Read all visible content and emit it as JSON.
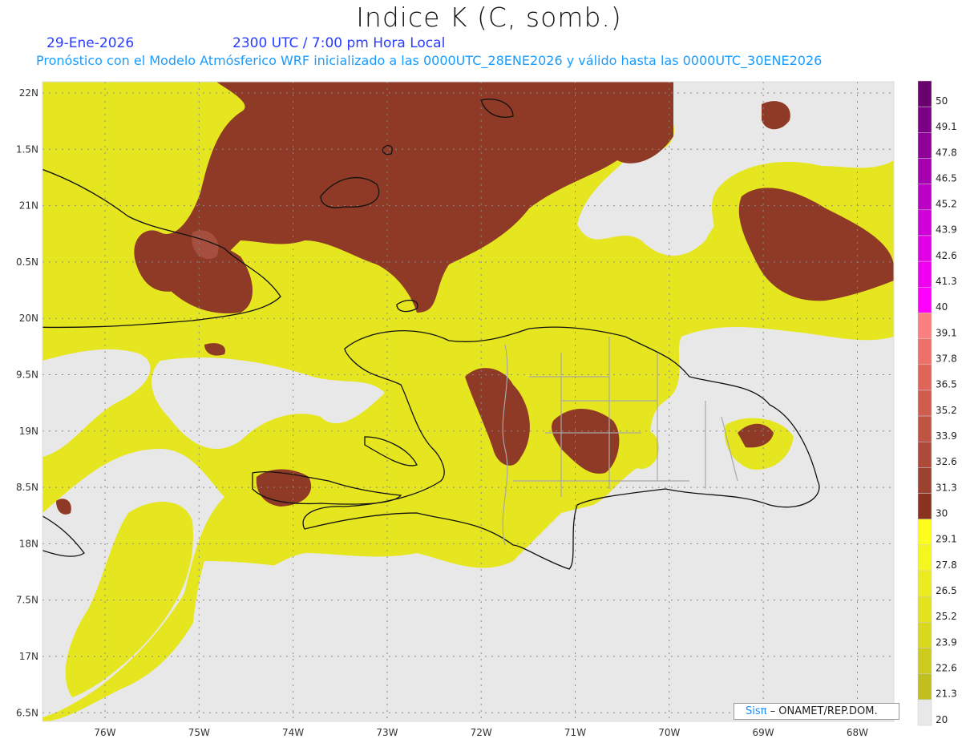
{
  "header": {
    "title": "Indice K (C, somb.)",
    "date": "29-Ene-2026",
    "time": "2300 UTC / 7:00 pm Hora Local",
    "description": "Pronóstico con el Modelo Atmósferico WRF inicializado a las 0000UTC_28ENE2026 y válido hasta las  0000UTC_30ENE2026"
  },
  "map": {
    "lat_labels": [
      "22N",
      "1.5N",
      "21N",
      "0.5N",
      "20N",
      "9.5N",
      "19N",
      "8.5N",
      "18N",
      "7.5N",
      "17N",
      "6.5N"
    ],
    "lon_labels": [
      "76W",
      "75W",
      "74W",
      "73W",
      "72W",
      "71W",
      "70W",
      "69W",
      "68W"
    ]
  },
  "colorbar": {
    "labels": [
      "50",
      "49.1",
      "47.8",
      "46.5",
      "45.2",
      "43.9",
      "42.6",
      "41.3",
      "40",
      "39.1",
      "37.8",
      "36.5",
      "35.2",
      "33.9",
      "32.6",
      "31.3",
      "30",
      "29.1",
      "27.8",
      "26.5",
      "25.2",
      "23.9",
      "22.6",
      "21.3",
      "20"
    ],
    "colors": [
      "#6a006e",
      "#7c0085",
      "#900099",
      "#a600b0",
      "#bc00c6",
      "#d000d8",
      "#e200e6",
      "#f000f0",
      "#ff00ff",
      "#fc7f7f",
      "#ef7068",
      "#e0645a",
      "#d05c4e",
      "#bf5444",
      "#ae4a3a",
      "#9c4230",
      "#8a3420",
      "#fdfd1e",
      "#f5f520",
      "#ebeb20",
      "#e2e21f",
      "#d8d81e",
      "#cccb1e",
      "#c0bf1f",
      "#e8e8e8"
    ]
  },
  "credit": {
    "sis": "Sisπ",
    "org": " –  ONAMET/REP.DOM."
  }
}
